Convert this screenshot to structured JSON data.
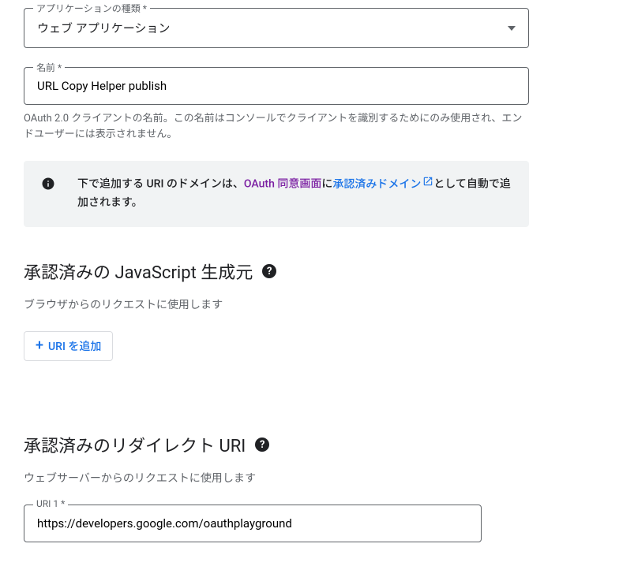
{
  "appTypeField": {
    "label": "アプリケーションの種類 *",
    "value": "ウェブ アプリケーション"
  },
  "nameField": {
    "label": "名前 *",
    "value": "URL Copy Helper publish",
    "helper": "OAuth 2.0 クライアントの名前。この名前はコンソールでクライアントを識別するためにのみ使用され、エンドユーザーには表示されません。"
  },
  "infoBanner": {
    "textPrefix": "下で追加する URI のドメインは、",
    "link1": "OAuth 同意画面",
    "textMid": "に",
    "link2": "承認済みドメイン",
    "textSuffix": "として自動で追加されます。"
  },
  "jsOriginsSection": {
    "title": "承認済みの JavaScript 生成元",
    "subtitle": "ブラウザからのリクエストに使用します",
    "addButton": "URI を追加"
  },
  "redirectSection": {
    "title": "承認済みのリダイレクト URI",
    "subtitle": "ウェブサーバーからのリクエストに使用します",
    "uri1": {
      "label": "URI 1 *",
      "value": "https://developers.google.com/oauthplayground"
    }
  }
}
